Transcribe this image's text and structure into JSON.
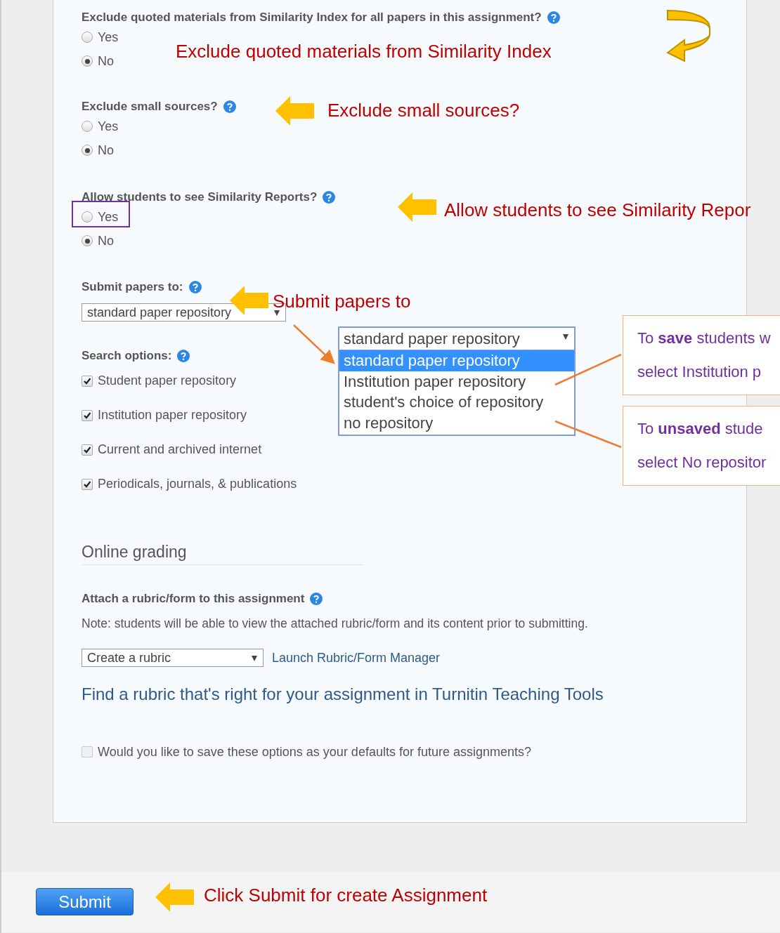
{
  "questions": [
    {
      "label": "Exclude quoted materials from Similarity Index for all papers in this assignment?",
      "options": [
        {
          "label": "Yes",
          "selected": false,
          "highlighted": false
        },
        {
          "label": "No",
          "selected": true,
          "highlighted": false
        }
      ]
    },
    {
      "label": "Exclude small sources?",
      "options": [
        {
          "label": "Yes",
          "selected": false,
          "highlighted": false
        },
        {
          "label": "No",
          "selected": true,
          "highlighted": false
        }
      ]
    },
    {
      "label": "Allow students to see Similarity Reports?",
      "options": [
        {
          "label": "Yes",
          "selected": false,
          "highlighted": true
        },
        {
          "label": "No",
          "selected": true,
          "highlighted": false
        }
      ]
    }
  ],
  "submit_to": {
    "label": "Submit papers to:",
    "value": "standard paper repository"
  },
  "dropdown_popup": {
    "value": "standard paper repository",
    "options": [
      {
        "label": "standard paper repository",
        "selected": true
      },
      {
        "label": "Institution paper repository",
        "selected": false
      },
      {
        "label": "student's choice of repository",
        "selected": false
      },
      {
        "label": "no repository",
        "selected": false
      }
    ]
  },
  "search_options": {
    "label": "Search options:",
    "items": [
      {
        "label": "Student paper repository",
        "checked": true
      },
      {
        "label": "Institution paper repository",
        "checked": true
      },
      {
        "label": "Current and archived internet",
        "checked": true
      },
      {
        "label": "Periodicals, journals, & publications",
        "checked": true
      }
    ]
  },
  "online_grading": {
    "heading": "Online grading",
    "attach_label": "Attach a rubric/form to this assignment",
    "note": "Note: students will be able to view the attached rubric/form and its content prior to submitting.",
    "rubric_select": "Create a rubric",
    "manager_link": "Launch Rubric/Form Manager",
    "find_link": "Find a rubric that's right for your assignment in Turnitin Teaching Tools"
  },
  "save_defaults": {
    "label": "Would you like to save these options as your defaults for future assignments?",
    "checked": false
  },
  "submit_button": "Submit",
  "annotations": [
    {
      "kind": "curved",
      "text": "Exclude quoted materials from Similarity Index"
    },
    {
      "kind": "arrow",
      "text": "Exclude small sources?"
    },
    {
      "kind": "arrow",
      "text": "Allow students to see Similarity Repor"
    },
    {
      "kind": "arrow",
      "text": "Submit papers to"
    },
    {
      "kind": "arrow",
      "text": "Click Submit for create Assignment"
    }
  ],
  "callouts": [
    {
      "lines": [
        "To **save** students w",
        "select Institution p"
      ]
    },
    {
      "lines": [
        "To **unsaved** stude",
        "select No repositor"
      ]
    }
  ]
}
